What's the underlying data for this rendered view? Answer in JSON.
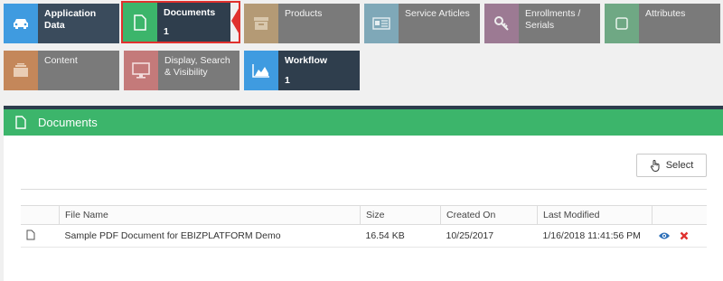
{
  "colors": {
    "application_data": "#3a4b5c",
    "documents": "#2f3e4d",
    "products": "#7a7a7a",
    "service_articles": "#7a7a7a",
    "enrollments": "#7a7a7a",
    "attributes": "#7a7a7a",
    "content": "#7a7a7a",
    "display": "#7a7a7a",
    "workflow": "#2f3e4d",
    "panel_header": "#3cb56b",
    "selected_outline": "#e0312e"
  },
  "tiles": [
    {
      "label": "Application Data",
      "icon": "car-icon",
      "count": ""
    },
    {
      "label": "Documents",
      "icon": "document-icon",
      "count": "1"
    },
    {
      "label": "Products",
      "icon": "box-icon",
      "count": ""
    },
    {
      "label": "Service Articles",
      "icon": "article-card-icon",
      "count": ""
    },
    {
      "label": "Enrollments / Serials",
      "icon": "key-icon",
      "count": ""
    },
    {
      "label": "Attributes",
      "icon": "square-icon",
      "count": ""
    },
    {
      "label": "Content",
      "icon": "content-icon",
      "count": ""
    },
    {
      "label": "Display, Search & Visibility",
      "icon": "monitor-icon",
      "count": ""
    },
    {
      "label": "Workflow",
      "icon": "chart-area-icon",
      "count": "1"
    }
  ],
  "panel": {
    "title": "Documents",
    "select_label": "Select"
  },
  "table": {
    "headers": [
      "",
      "File Name",
      "Size",
      "Created On",
      "Last Modified",
      ""
    ],
    "rows": [
      {
        "file_name": "Sample PDF Document for EBIZPLATFORM Demo",
        "size": "16.54 KB",
        "created_on": "10/25/2017",
        "last_modified": "1/16/2018 11:41:56 PM"
      }
    ]
  }
}
